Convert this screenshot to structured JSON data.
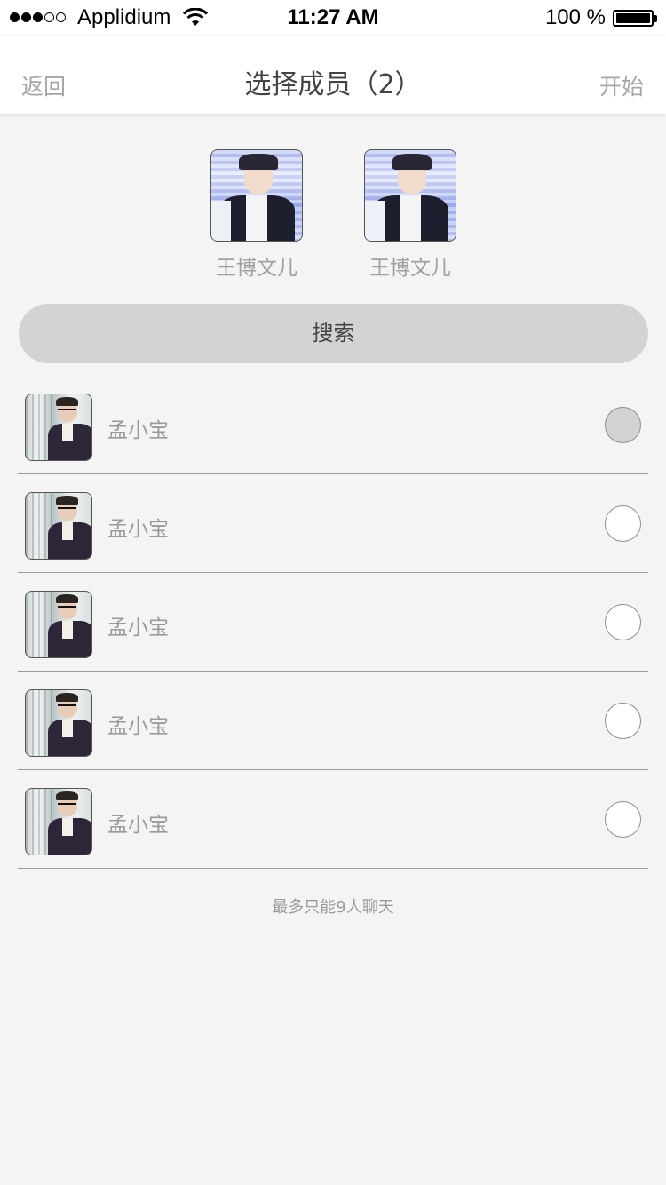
{
  "status_bar": {
    "carrier": "Applidium",
    "time": "11:27 AM",
    "battery_percent": "100 %",
    "signal_bars_filled": 3,
    "signal_bars_total": 5
  },
  "nav": {
    "back_label": "返回",
    "title": "选择成员（2）",
    "start_label": "开始"
  },
  "selected_members": [
    {
      "name": "王博文儿",
      "avatar": "photo-young-man-crown"
    },
    {
      "name": "王博文儿",
      "avatar": "photo-young-man-crown"
    }
  ],
  "search": {
    "label": "搜索"
  },
  "members": [
    {
      "name": "孟小宝",
      "avatar": "photo-man-glasses",
      "checked": true
    },
    {
      "name": "孟小宝",
      "avatar": "photo-man-glasses",
      "checked": false
    },
    {
      "name": "孟小宝",
      "avatar": "photo-man-glasses",
      "checked": false
    },
    {
      "name": "孟小宝",
      "avatar": "photo-man-glasses",
      "checked": false
    },
    {
      "name": "孟小宝",
      "avatar": "photo-man-glasses",
      "checked": false
    }
  ],
  "footer_note": "最多只能9人聊天",
  "colors": {
    "background": "#f4f4f4",
    "nav_background": "#ffffff",
    "search_background": "#d3d3d3",
    "secondary_text": "#a6a6a6",
    "checked_radio": "#d3d3d3"
  }
}
